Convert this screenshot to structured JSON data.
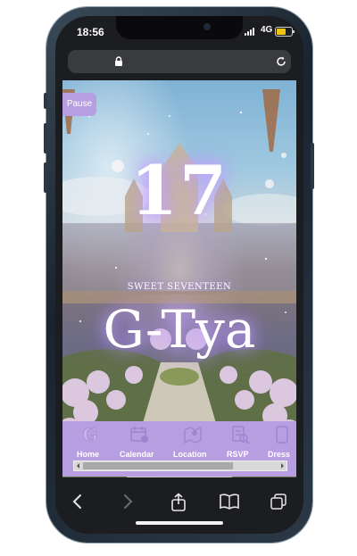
{
  "status_bar": {
    "time": "18:56",
    "network": "4G",
    "battery_level": 0.6
  },
  "browser": {
    "url": ""
  },
  "hero": {
    "pause_label": "Pause",
    "number": "17",
    "subtitle": "SWEET SEVENTEEN",
    "name": "G-Tya"
  },
  "nav": {
    "items": [
      {
        "label": "Home",
        "icon": "g-logo-icon"
      },
      {
        "label": "Calendar",
        "icon": "calendar-icon"
      },
      {
        "label": "Location",
        "icon": "map-pin-icon"
      },
      {
        "label": "RSVP",
        "icon": "rsvp-icon"
      },
      {
        "label": "Dress",
        "icon": "dress-icon"
      }
    ]
  },
  "colors": {
    "accent": "#b79ee0",
    "glow": "#c9a6ff",
    "battery": "#f1c40f"
  }
}
